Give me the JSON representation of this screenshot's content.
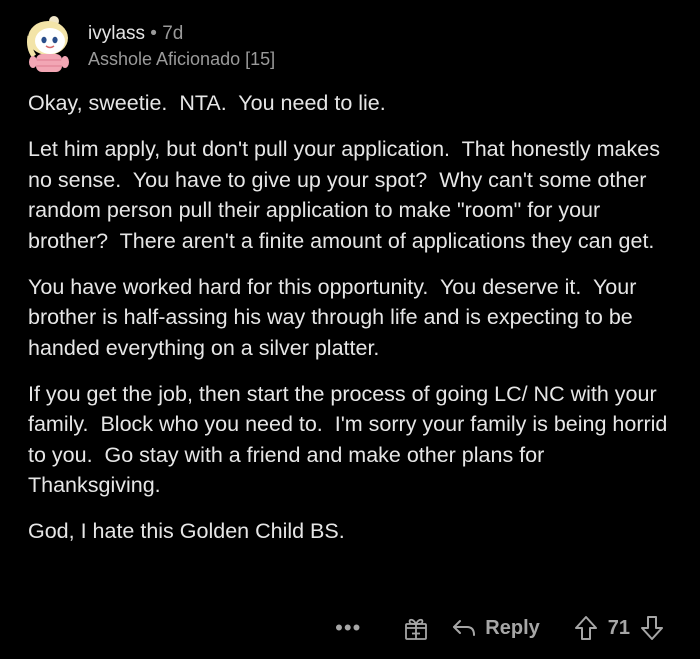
{
  "comment": {
    "username": "ivylass",
    "separator": "•",
    "age": "7d",
    "flair": "Asshole Aficionado [15]",
    "paragraphs": [
      "Okay, sweetie.  NTA.  You need to lie.",
      "Let him apply, but don't pull your application.  That honestly makes no sense.  You have to give up your spot?  Why can't some other random person pull their application to make \"room\" for your brother?  There aren't a finite amount of applications they can get.",
      "You have worked hard for this opportunity.  You deserve it.  Your brother is half-assing his way through life and is expecting to be handed everything on a silver platter.",
      "If you get the job, then start the process of going LC/ NC with your family.  Block who you need to.  I'm sorry your family is being horrid to you.  Go stay with a friend and make other plans for Thanksgiving.",
      "God, I hate this Golden Child BS."
    ]
  },
  "actions": {
    "more_label": "•••",
    "reply_label": "Reply",
    "score": "71"
  },
  "icons": {
    "avatar": "snoo-avatar-icon",
    "more": "more-options-icon",
    "award": "gift-award-icon",
    "reply": "reply-arrow-icon",
    "upvote": "upvote-arrow-icon",
    "downvote": "downvote-arrow-icon"
  },
  "colors": {
    "background": "#000000",
    "text": "#e6e6e6",
    "muted": "#9a9a9a",
    "action": "#a6a6a6"
  }
}
